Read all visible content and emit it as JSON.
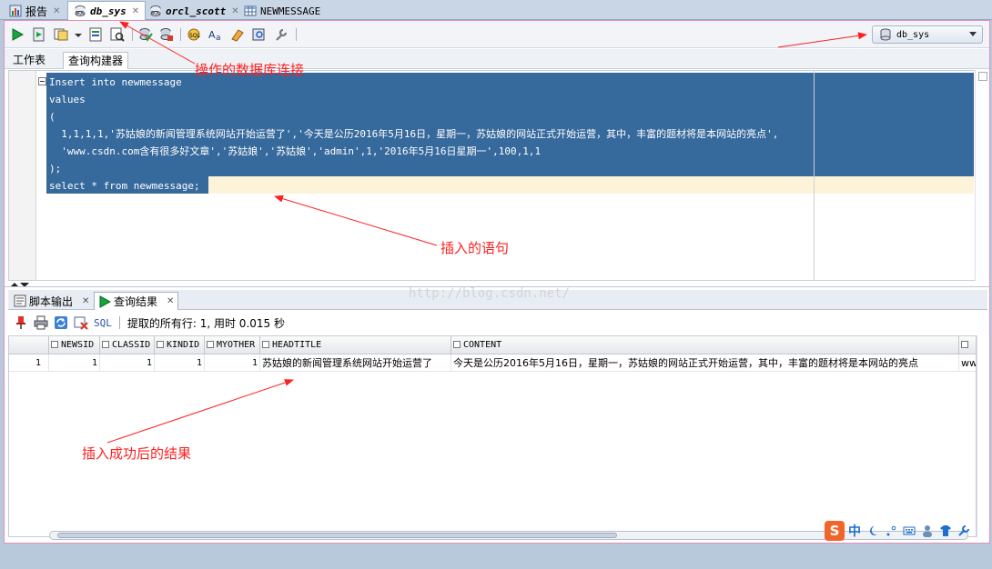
{
  "tabs": [
    {
      "label": "报告",
      "icon": "report-icon"
    },
    {
      "label": "db_sys",
      "icon": "sql-worksheet-icon",
      "active": true
    },
    {
      "label": "orcl_scott",
      "icon": "sql-worksheet-icon"
    },
    {
      "label": "NEWMESSAGE",
      "icon": "table-icon"
    }
  ],
  "toolbar": {
    "connection": "db_sys",
    "buttons": [
      "run-statement-icon",
      "run-script-icon",
      "autotrace-icon",
      "dropdown-icon",
      "explain-plan-icon",
      "sql-tuning-icon",
      "commit-icon",
      "rollback-icon",
      "sql-history-icon",
      "case-icon",
      "clear-icon",
      "find-icon",
      "tools-icon"
    ]
  },
  "subtabs": [
    "工作表",
    "查询构建器"
  ],
  "editor": {
    "lines": [
      "Insert into newmessage",
      "values",
      "(",
      "  1,1,1,1,'苏姑娘的新闻管理系统网站开始运营了','今天是公历2016年5月16日，星期一，苏姑娘的网站正式开始运营，其中，丰富的题材将是本网站的亮点',",
      "  'www.csdn.com含有很多好文章','苏姑娘','苏姑娘','admin',1,'2016年5月16日星期一',100,1,1",
      ");",
      "select * from newmessage;"
    ]
  },
  "output_tabs": [
    {
      "label": "脚本输出",
      "icon": "script-output-icon"
    },
    {
      "label": "查询结果",
      "icon": "query-result-icon",
      "active": true
    }
  ],
  "output_bar": {
    "sql_link": "SQL",
    "fetch_status": "提取的所有行: 1, 用时 0.015 秒"
  },
  "grid": {
    "columns": [
      "NEWSID",
      "CLASSID",
      "KINDID",
      "MYOTHER",
      "HEADTITLE",
      "CONTENT"
    ],
    "rows": [
      {
        "row_num": "1",
        "cells": [
          "1",
          "1",
          "1",
          "1",
          "苏姑娘的新闻管理系统网站开始运营了",
          "今天是公历2016年5月16日，星期一，苏姑娘的网站正式开始运营，其中，丰富的题材将是本网站的亮点"
        ],
        "overflow": "ww"
      }
    ]
  },
  "annotations": {
    "db_connection": "操作的数据库连接",
    "insert_statement": "插入的语句",
    "insert_result": "插入成功后的结果"
  },
  "watermark": "http://blog.csdn.net/",
  "ime": {
    "logo": "S",
    "mode": "中"
  },
  "colors": {
    "selection": "#36699c",
    "annotation": "#ff1f1f",
    "frame": "#e48fb8"
  }
}
